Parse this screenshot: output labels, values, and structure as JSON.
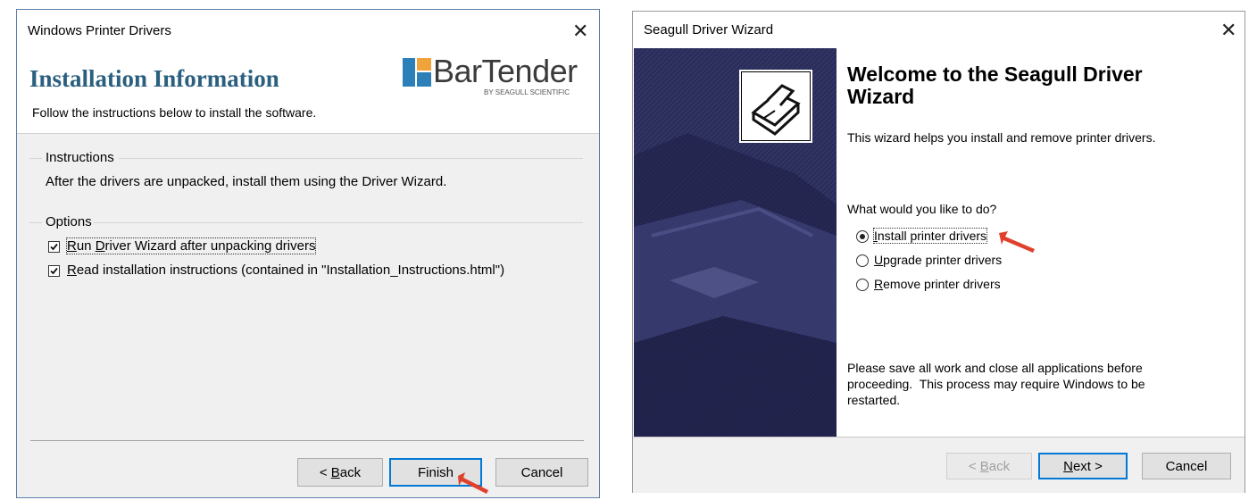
{
  "left_dialog": {
    "title": "Windows Printer Drivers",
    "header_title": "Installation Information",
    "header_subtitle": "Follow the instructions below to install the software.",
    "logo_text": "BarTender",
    "logo_tagline": "BY SEAGULL SCIENTIFIC",
    "instructions_label": "Instructions",
    "instructions_text": "After the drivers are unpacked, install them using the Driver Wizard.",
    "options_label": "Options",
    "options": [
      {
        "label": "Run Driver Wizard after unpacking drivers",
        "checked": true
      },
      {
        "label": "Read installation instructions (contained in \"Installation_Instructions.html\")",
        "checked": true
      }
    ],
    "buttons": {
      "back_prefix": "< ",
      "back_mnemonic": "B",
      "back_rest": "ack",
      "finish": "Finish",
      "cancel": "Cancel"
    }
  },
  "right_dialog": {
    "title": "Seagull Driver Wizard",
    "heading": "Welcome to the Seagull Driver Wizard",
    "intro": "This wizard helps you install and remove printer drivers.",
    "question": "What would you like to do?",
    "choices": [
      {
        "mnemonic": "I",
        "rest": "nstall printer drivers",
        "selected": true
      },
      {
        "mnemonic": "U",
        "rest": "pgrade printer drivers",
        "selected": false
      },
      {
        "mnemonic": "R",
        "rest": "emove printer drivers",
        "selected": false
      }
    ],
    "notice": [
      "Please save all work and close all applications before",
      "proceeding.  This process may require Windows to be",
      "restarted."
    ],
    "buttons": {
      "back_prefix": "< ",
      "back_mnemonic": "B",
      "back_rest": "ack",
      "next_mnemonic": "N",
      "next_rest": "ext >",
      "cancel": "Cancel"
    }
  },
  "colors": {
    "heading_blue": "#2b5f7f",
    "sidebar_navy": "#2b2d59",
    "annotation_arrow": "#e0412c",
    "accent_focus": "#0078d7"
  }
}
